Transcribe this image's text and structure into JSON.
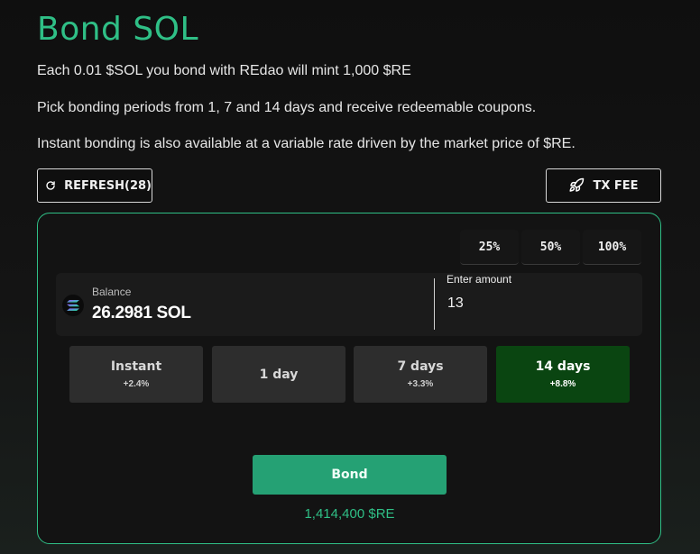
{
  "header": {
    "title": "Bond SOL"
  },
  "description": {
    "line1": "Each 0.01 $SOL you bond with REdao will mint 1,000 $RE",
    "line2": "Pick bonding periods from 1, 7 and 14 days and receive redeemable coupons.",
    "line3": "Instant bonding is also available at a variable rate driven by the market price of $RE."
  },
  "toolbar": {
    "refresh_label": "REFRESH(28)",
    "refresh_icon": "refresh-icon",
    "txfee_label": "TX FEE",
    "txfee_icon": "rocket-icon"
  },
  "percent_buttons": [
    "25%",
    "50%",
    "100%"
  ],
  "balance": {
    "label": "Balance",
    "value": "26.2981 SOL",
    "token_icon": "solana-icon"
  },
  "amount": {
    "label": "Enter amount",
    "value": "13"
  },
  "periods": [
    {
      "label": "Instant",
      "rate": "+2.4%",
      "selected": false
    },
    {
      "label": "1 day",
      "rate": "",
      "selected": false
    },
    {
      "label": "7 days",
      "rate": "+3.3%",
      "selected": false
    },
    {
      "label": "14 days",
      "rate": "+8.8%",
      "selected": true
    }
  ],
  "bond": {
    "button_label": "Bond",
    "mint_estimate": "1,414,400 $RE"
  },
  "colors": {
    "accent": "#2fbf86",
    "bond_button": "#25a174",
    "selected_period": "#0a4511"
  }
}
